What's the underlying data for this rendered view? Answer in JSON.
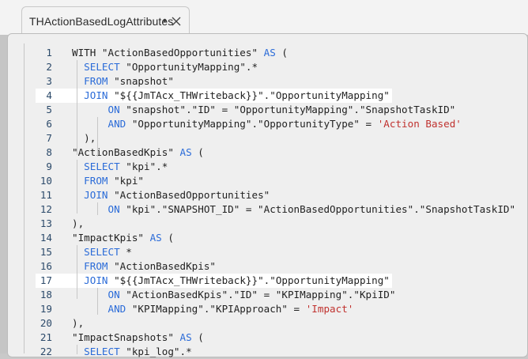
{
  "tab": {
    "title": "THActionBasedLogAttributes",
    "modified_marker": "•",
    "close_icon": "close-icon"
  },
  "editor": {
    "highlight_color": "#ffffff",
    "keyword_color": "#2a6bd8",
    "string_color": "#c0322f",
    "lines": [
      {
        "n": "1",
        "highlight": false,
        "tokens": [
          [
            "t",
            "WITH \"ActionBasedOpportunities\" "
          ],
          [
            "k",
            "AS"
          ],
          [
            "t",
            " ("
          ]
        ]
      },
      {
        "n": "2",
        "highlight": false,
        "tokens": [
          [
            "t",
            "  "
          ],
          [
            "k",
            "SELECT"
          ],
          [
            "t",
            " \"OpportunityMapping\".*"
          ]
        ]
      },
      {
        "n": "3",
        "highlight": false,
        "tokens": [
          [
            "t",
            "  "
          ],
          [
            "k",
            "FROM"
          ],
          [
            "t",
            " \"snapshot\""
          ]
        ]
      },
      {
        "n": "4",
        "highlight": true,
        "tokens": [
          [
            "t",
            "  "
          ],
          [
            "k",
            "JOIN"
          ],
          [
            "t",
            " \"${{JmTAcx_THWriteback}}\".\"OpportunityMapping\""
          ]
        ]
      },
      {
        "n": "5",
        "highlight": false,
        "tokens": [
          [
            "t",
            "      "
          ],
          [
            "k",
            "ON"
          ],
          [
            "t",
            " \"snapshot\".\"ID\" = \"OpportunityMapping\".\"SnapshotTaskID\""
          ]
        ]
      },
      {
        "n": "6",
        "highlight": false,
        "tokens": [
          [
            "t",
            "      "
          ],
          [
            "k",
            "AND"
          ],
          [
            "t",
            " \"OpportunityMapping\".\"OpportunityType\" = "
          ],
          [
            "s",
            "'Action Based'"
          ]
        ]
      },
      {
        "n": "7",
        "highlight": false,
        "tokens": [
          [
            "t",
            "  ),"
          ]
        ]
      },
      {
        "n": "8",
        "highlight": false,
        "tokens": [
          [
            "t",
            "\"ActionBasedKpis\" "
          ],
          [
            "k",
            "AS"
          ],
          [
            "t",
            " ("
          ]
        ]
      },
      {
        "n": "9",
        "highlight": false,
        "tokens": [
          [
            "t",
            "  "
          ],
          [
            "k",
            "SELECT"
          ],
          [
            "t",
            " \"kpi\".*"
          ]
        ]
      },
      {
        "n": "10",
        "highlight": false,
        "tokens": [
          [
            "t",
            "  "
          ],
          [
            "k",
            "FROM"
          ],
          [
            "t",
            " \"kpi\""
          ]
        ]
      },
      {
        "n": "11",
        "highlight": false,
        "tokens": [
          [
            "t",
            "  "
          ],
          [
            "k",
            "JOIN"
          ],
          [
            "t",
            " \"ActionBasedOpportunities\""
          ]
        ]
      },
      {
        "n": "12",
        "highlight": false,
        "tokens": [
          [
            "t",
            "      "
          ],
          [
            "k",
            "ON"
          ],
          [
            "t",
            " \"kpi\".\"SNAPSHOT_ID\" = \"ActionBasedOpportunities\".\"SnapshotTaskID\""
          ]
        ]
      },
      {
        "n": "13",
        "highlight": false,
        "tokens": [
          [
            "t",
            "),"
          ]
        ]
      },
      {
        "n": "14",
        "highlight": false,
        "tokens": [
          [
            "t",
            "\"ImpactKpis\" "
          ],
          [
            "k",
            "AS"
          ],
          [
            "t",
            " ("
          ]
        ]
      },
      {
        "n": "15",
        "highlight": false,
        "tokens": [
          [
            "t",
            "  "
          ],
          [
            "k",
            "SELECT"
          ],
          [
            "t",
            " *"
          ]
        ]
      },
      {
        "n": "16",
        "highlight": false,
        "tokens": [
          [
            "t",
            "  "
          ],
          [
            "k",
            "FROM"
          ],
          [
            "t",
            " \"ActionBasedKpis\""
          ]
        ]
      },
      {
        "n": "17",
        "highlight": true,
        "tokens": [
          [
            "t",
            "  "
          ],
          [
            "k",
            "JOIN"
          ],
          [
            "t",
            " \"${{JmTAcx_THWriteback}}\".\"OpportunityMapping\""
          ]
        ]
      },
      {
        "n": "18",
        "highlight": false,
        "tokens": [
          [
            "t",
            "      "
          ],
          [
            "k",
            "ON"
          ],
          [
            "t",
            " \"ActionBasedKpis\".\"ID\" = \"KPIMapping\".\"KpiID\""
          ]
        ]
      },
      {
        "n": "19",
        "highlight": false,
        "tokens": [
          [
            "t",
            "      "
          ],
          [
            "k",
            "AND"
          ],
          [
            "t",
            " \"KPIMapping\".\"KPIApproach\" = "
          ],
          [
            "s",
            "'Impact'"
          ]
        ]
      },
      {
        "n": "20",
        "highlight": false,
        "tokens": [
          [
            "t",
            "),"
          ]
        ]
      },
      {
        "n": "21",
        "highlight": false,
        "tokens": [
          [
            "t",
            "\"ImpactSnapshots\" "
          ],
          [
            "k",
            "AS"
          ],
          [
            "t",
            " ("
          ]
        ]
      },
      {
        "n": "22",
        "highlight": false,
        "tokens": [
          [
            "t",
            "  "
          ],
          [
            "k",
            "SELECT"
          ],
          [
            "t",
            " \"kpi_log\".*"
          ]
        ]
      }
    ]
  }
}
